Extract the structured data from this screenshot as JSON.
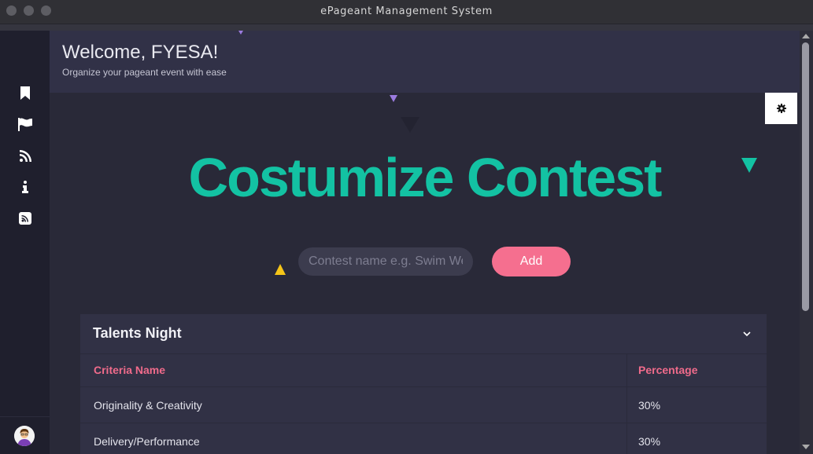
{
  "window": {
    "title": "ePageant Management System"
  },
  "sidebar": {
    "icons": [
      "bookmark-icon",
      "flag-icon",
      "rss-icon",
      "info-icon",
      "rss-square-icon"
    ],
    "avatar": "user-avatar"
  },
  "header": {
    "welcome": "Welcome, FYESA!",
    "subtitle": "Organize your pageant event with ease"
  },
  "main": {
    "settings_icon": "gear-icon",
    "title": "Costumize Contest",
    "contest_input": {
      "value": "",
      "placeholder": "Contest name e.g. Swim Wear"
    },
    "add_label": "Add"
  },
  "contest_card": {
    "title": "Talents Night",
    "expand_icon": "chevron-down-icon",
    "columns": [
      "Criteria Name",
      "Percentage"
    ],
    "rows": [
      [
        "Originality & Creativity",
        "30%"
      ],
      [
        "Delivery/Performance",
        "30%"
      ]
    ]
  },
  "colors": {
    "accent_teal": "#13c2a3",
    "accent_pink": "#f56f8f",
    "header_bg": "#313147",
    "sidebar_bg": "#1f1f2d",
    "main_bg": "#292938"
  }
}
